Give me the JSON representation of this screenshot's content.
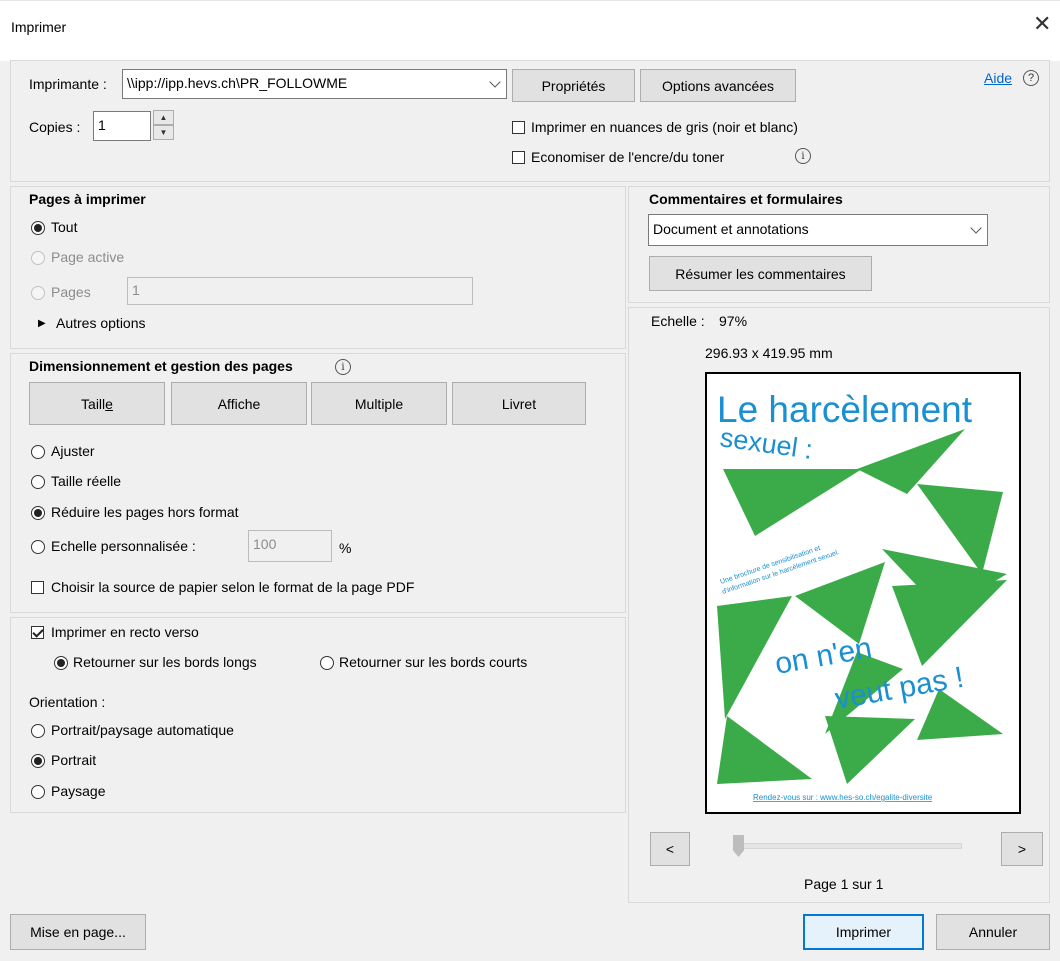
{
  "dialog": {
    "title": "Imprimer",
    "close_glyph": "✕",
    "close_icon": "close-icon"
  },
  "printer": {
    "label": "Imprimante :",
    "value": "\\\\ipp://ipp.hevs.ch\\PR_FOLLOWME",
    "properties_label": "Propriétés",
    "advanced_label": "Options avancées",
    "help_label": "Aide",
    "help_icon": "help-icon",
    "copies_label": "Copies :",
    "copies_value": "1",
    "grayscale_label": "Imprimer en nuances de gris (noir et blanc)",
    "grayscale_checked": false,
    "save_ink_label": "Economiser de l'encre/du toner",
    "save_ink_checked": false,
    "info_icon": "info-icon"
  },
  "pages": {
    "heading": "Pages à imprimer",
    "all_label": "Tout",
    "current_label": "Page active",
    "pages_label": "Pages",
    "pages_value": "1",
    "more_label": "Autres options",
    "selected": "all"
  },
  "sizing": {
    "heading": "Dimensionnement et gestion des pages",
    "tabs": [
      "Taille",
      "Affiche",
      "Multiple",
      "Livret"
    ],
    "fit_label": "Ajuster",
    "actual_label": "Taille réelle",
    "shrink_label": "Réduire les pages hors format",
    "custom_label": "Echelle personnalisée :",
    "custom_value": "100",
    "percent": "%",
    "paper_source_label": "Choisir la source de papier selon le format de la page PDF",
    "selected": "shrink"
  },
  "duplex": {
    "label": "Imprimer en recto verso",
    "checked": true,
    "long_label": "Retourner sur les bords longs",
    "short_label": "Retourner sur les bords courts",
    "selected": "long",
    "orientation_label": "Orientation :",
    "auto_label": "Portrait/paysage automatique",
    "portrait_label": "Portrait",
    "landscape_label": "Paysage",
    "orientation_selected": "portrait"
  },
  "comments": {
    "heading": "Commentaires et formulaires",
    "value": "Document et annotations",
    "summarize_label": "Résumer les commentaires"
  },
  "preview": {
    "scale_label": "Echelle :",
    "scale_value": "97%",
    "size_text": "296.93 x 419.95 mm",
    "poster_title": "Le harcèlement",
    "poster_subtitle": "sexuel :",
    "poster_side_text_1": "Une brochure de sensibilisation et",
    "poster_side_text_2": "d'information sur le harcèlement sexuel.",
    "poster_slogan_1": "on n'en",
    "poster_slogan_2": "veut pas !",
    "poster_footer": "Rendez-vous sur : www.hes-so.ch/egalite-diversite",
    "poster_accent": "#1a8fd1",
    "poster_green": "#3bab4a",
    "prev_label": "<",
    "next_label": ">",
    "page_indicator": "Page 1 sur 1",
    "page_fraction": 0.0
  },
  "footer": {
    "setup_label": "Mise en page...",
    "print_label": "Imprimer",
    "cancel_label": "Annuler"
  }
}
